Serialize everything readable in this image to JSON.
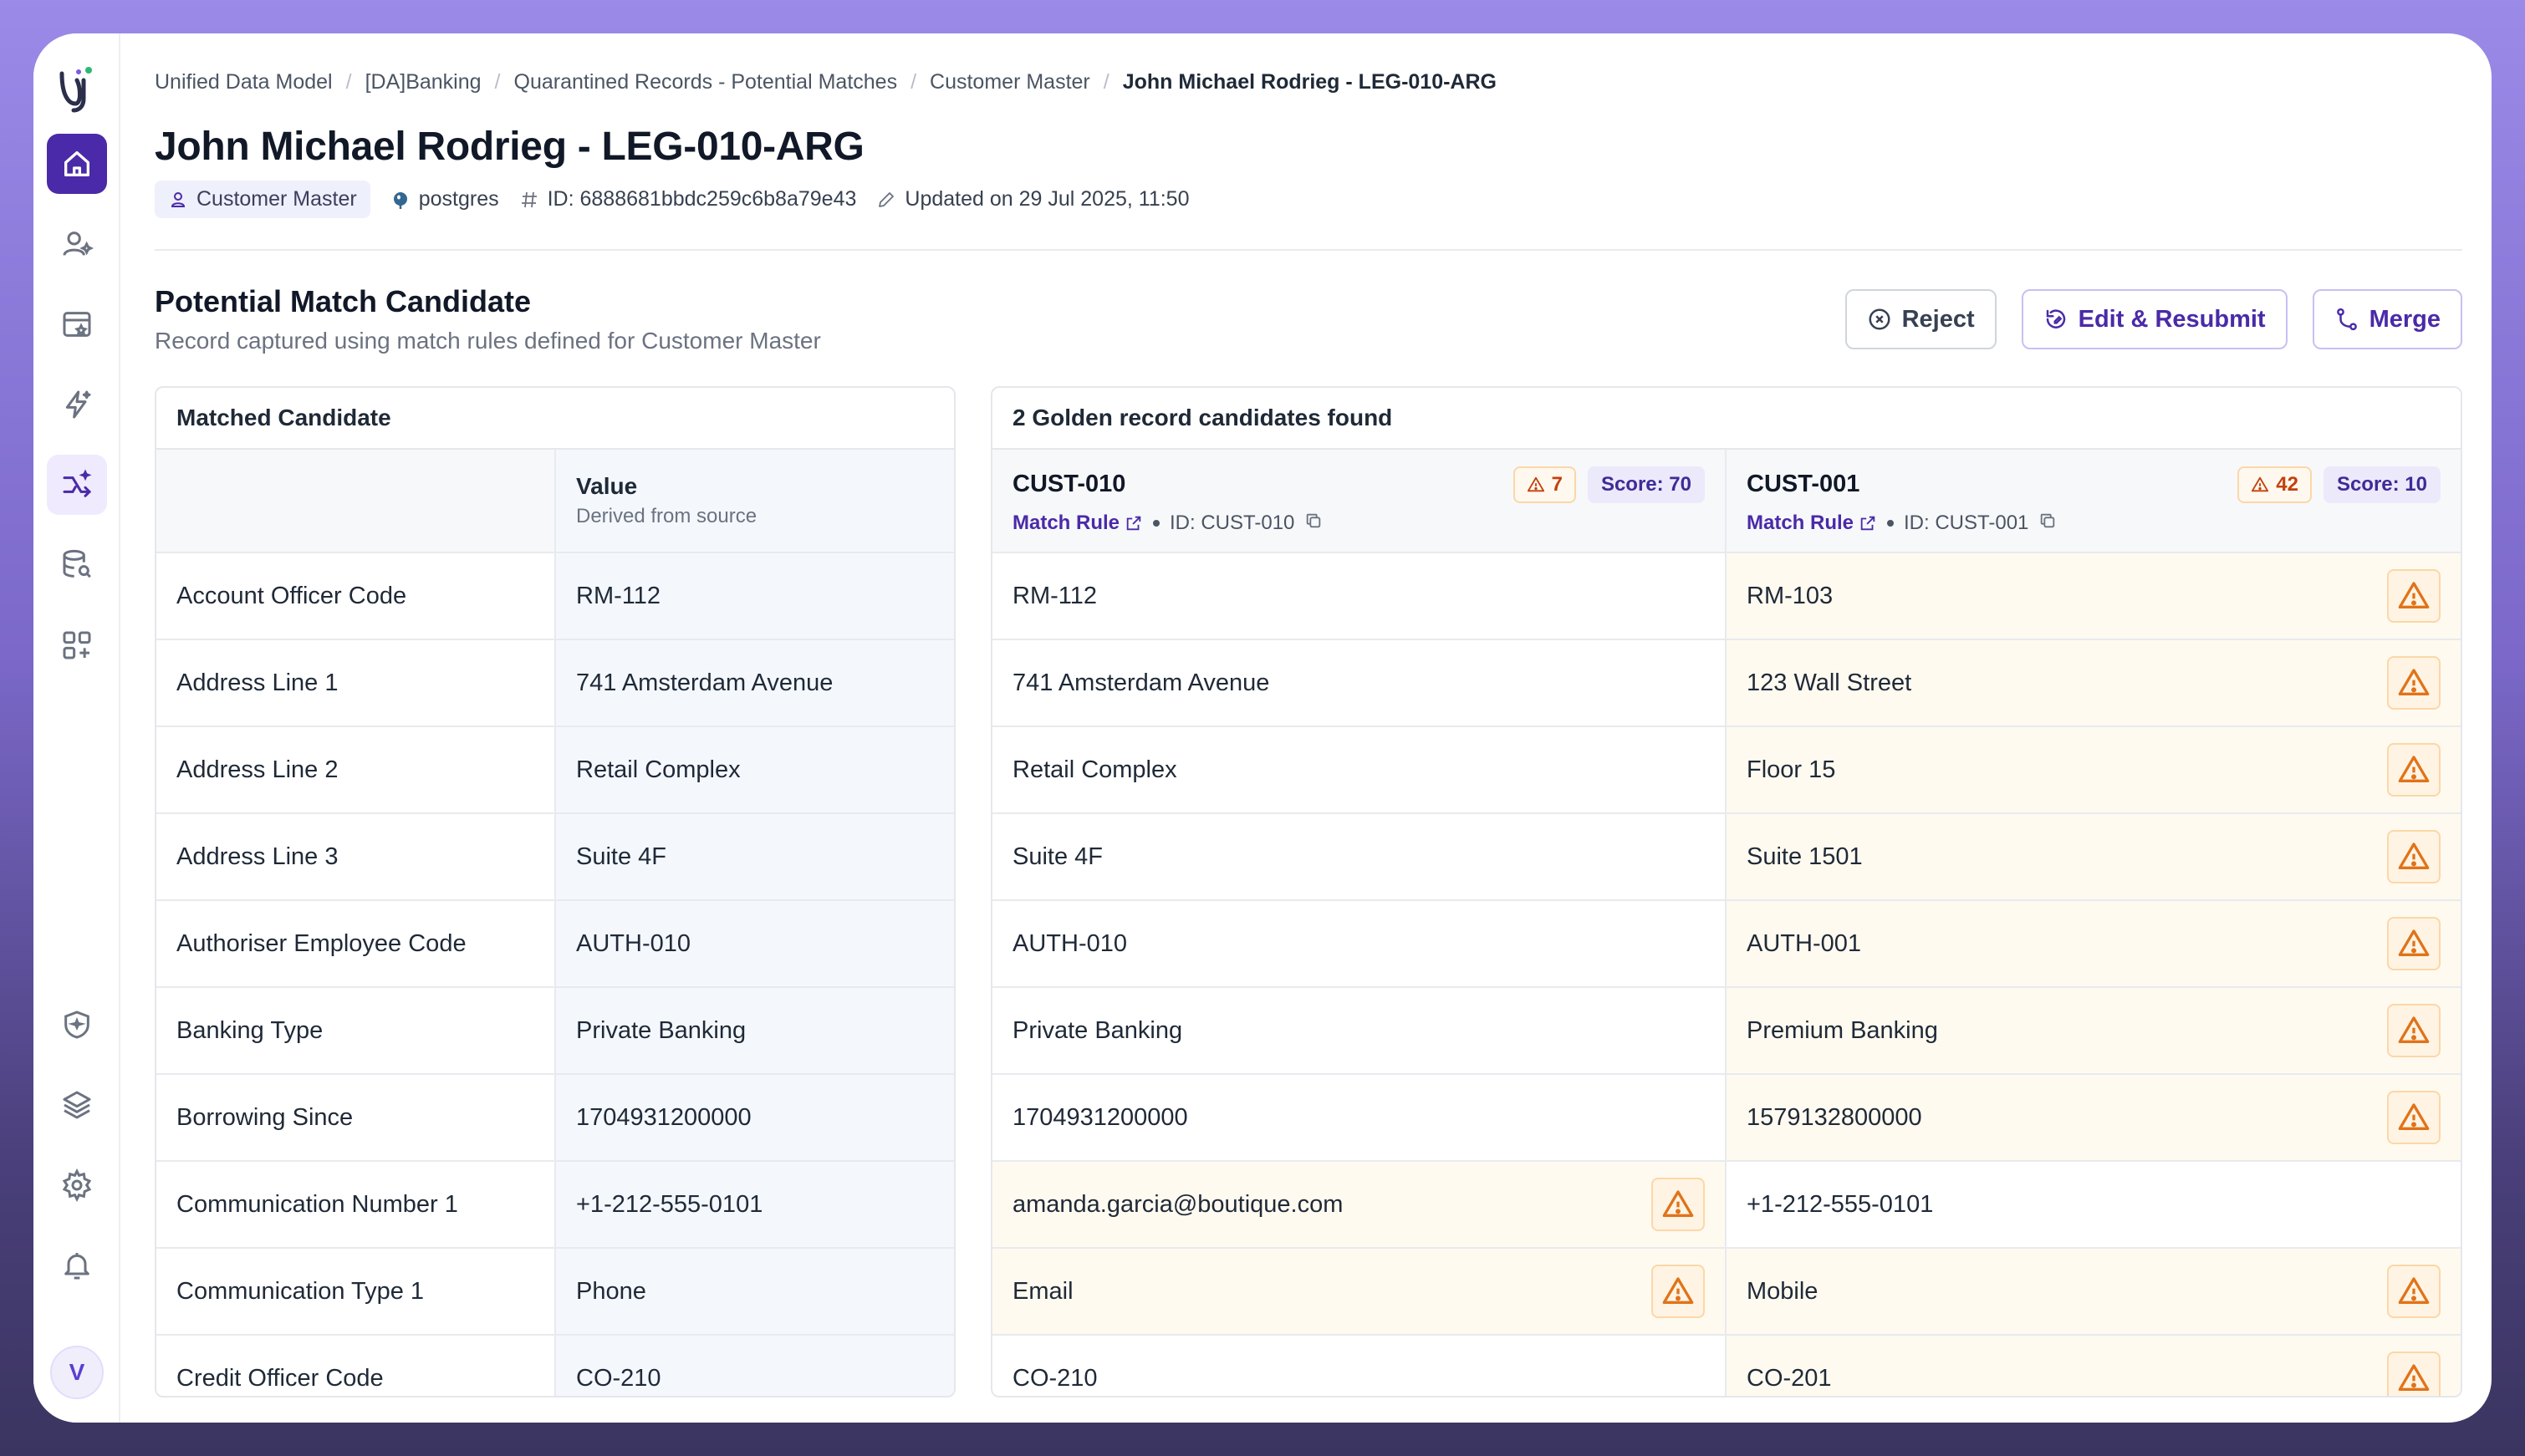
{
  "breadcrumb": [
    "Unified Data Model",
    "[DA]Banking",
    "Quarantined Records - Potential Matches",
    "Customer Master",
    "John Michael Rodrieg - LEG-010-ARG"
  ],
  "page": {
    "title": "John Michael Rodrieg - LEG-010-ARG",
    "entity": "Customer Master",
    "source": "postgres",
    "id_text": "ID: 6888681bbdc259c6b8a79e43",
    "updated_text": "Updated on 29 Jul 2025, 11:50"
  },
  "section": {
    "title": "Potential Match Candidate",
    "subtitle": "Record captured using match rules defined for Customer Master"
  },
  "actions": {
    "reject": "Reject",
    "edit": "Edit & Resubmit",
    "merge": "Merge"
  },
  "left_panel": {
    "title": "Matched Candidate",
    "value_head": "Value",
    "value_sub": "Derived from source"
  },
  "right_panel": {
    "title": "2 Golden record candidates found",
    "candidates": [
      {
        "name": "CUST-010",
        "warnings": "7",
        "score": "Score: 70",
        "rule": "Match Rule",
        "id": "ID: CUST-010"
      },
      {
        "name": "CUST-001",
        "warnings": "42",
        "score": "Score: 10",
        "rule": "Match Rule",
        "id": "ID: CUST-001"
      }
    ]
  },
  "rows": [
    {
      "field": "Account Officer Code",
      "value": "RM-112",
      "c1": "RM-112",
      "c1_diff": false,
      "c2": "RM-103",
      "c2_diff": true
    },
    {
      "field": "Address Line 1",
      "value": "741 Amsterdam Avenue",
      "c1": "741 Amsterdam Avenue",
      "c1_diff": false,
      "c2": "123 Wall Street",
      "c2_diff": true
    },
    {
      "field": "Address Line 2",
      "value": "Retail Complex",
      "c1": "Retail Complex",
      "c1_diff": false,
      "c2": "Floor 15",
      "c2_diff": true
    },
    {
      "field": "Address Line 3",
      "value": "Suite 4F",
      "c1": "Suite 4F",
      "c1_diff": false,
      "c2": "Suite 1501",
      "c2_diff": true
    },
    {
      "field": "Authoriser Employee Code",
      "value": "AUTH-010",
      "c1": "AUTH-010",
      "c1_diff": false,
      "c2": "AUTH-001",
      "c2_diff": true
    },
    {
      "field": "Banking Type",
      "value": "Private Banking",
      "c1": "Private Banking",
      "c1_diff": false,
      "c2": "Premium Banking",
      "c2_diff": true
    },
    {
      "field": "Borrowing Since",
      "value": "1704931200000",
      "c1": "1704931200000",
      "c1_diff": false,
      "c2": "1579132800000",
      "c2_diff": true
    },
    {
      "field": "Communication Number 1",
      "value": "+1-212-555-0101",
      "c1": "amanda.garcia@boutique.com",
      "c1_diff": true,
      "c2": "+1-212-555-0101",
      "c2_diff": false
    },
    {
      "field": "Communication Type 1",
      "value": "Phone",
      "c1": "Email",
      "c1_diff": true,
      "c2": "Mobile",
      "c2_diff": true
    },
    {
      "field": "Credit Officer Code",
      "value": "CO-210",
      "c1": "CO-210",
      "c1_diff": false,
      "c2": "CO-201",
      "c2_diff": true
    }
  ],
  "user": {
    "initial": "V"
  }
}
